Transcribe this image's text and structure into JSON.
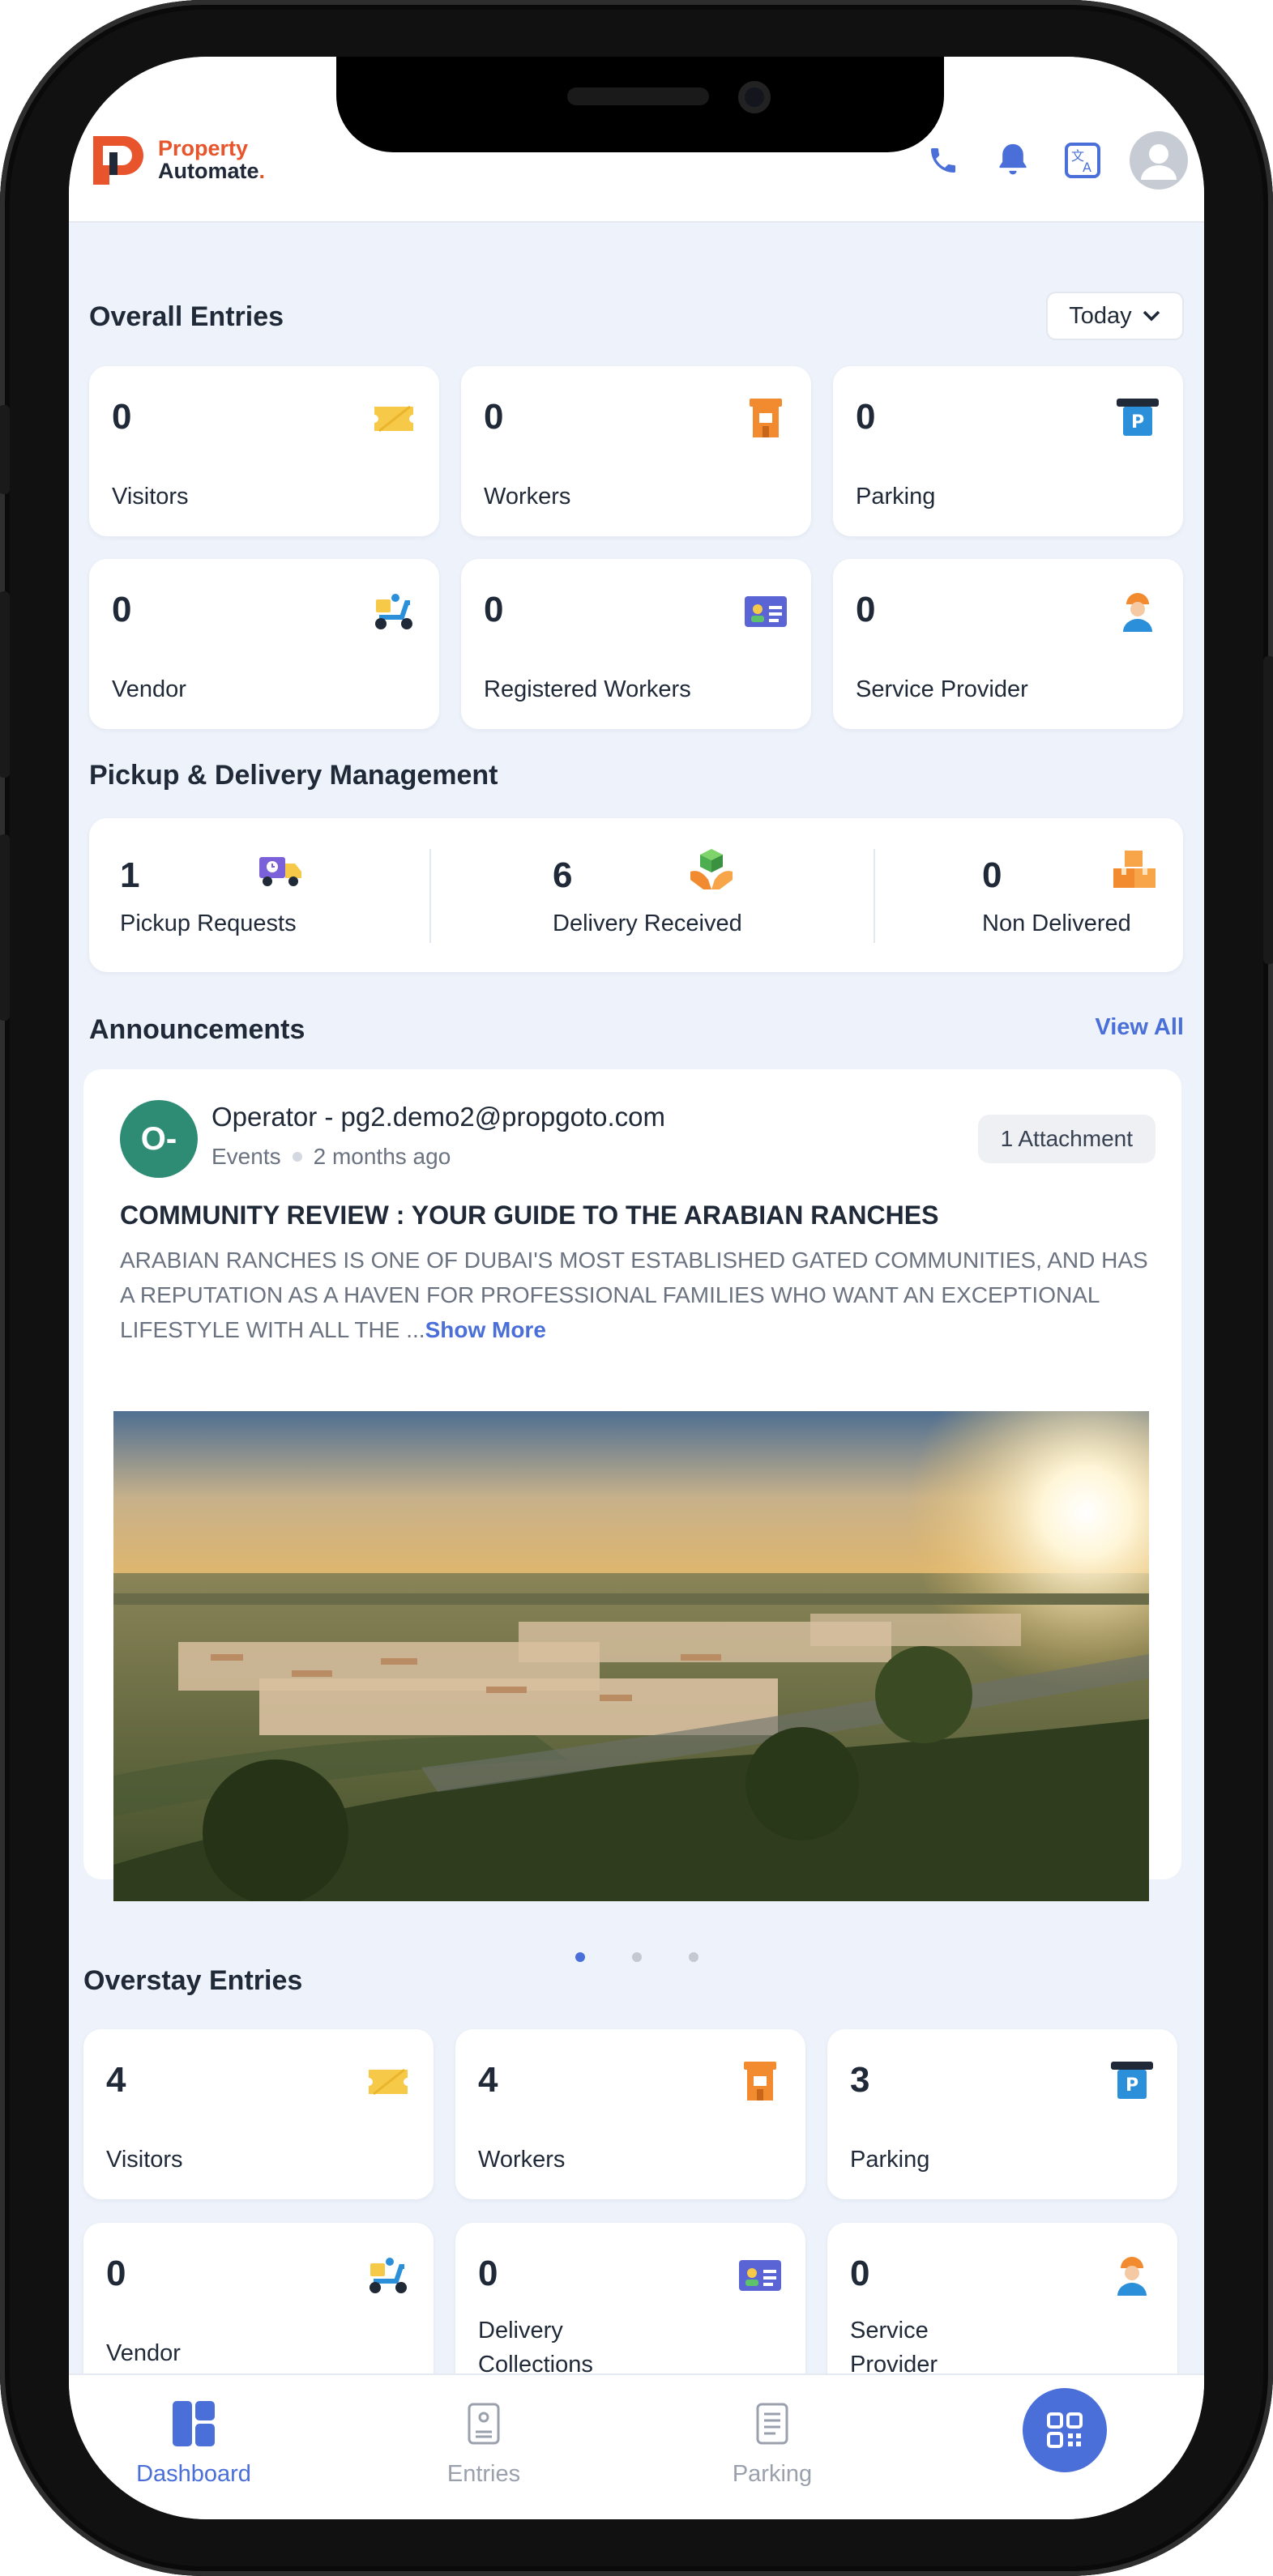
{
  "header": {
    "logo_line1": "Property",
    "logo_line2": "Automate",
    "icons": [
      "phone-icon",
      "bell-icon",
      "translate-icon",
      "avatar"
    ]
  },
  "overall": {
    "title": "Overall Entries",
    "filter": "Today",
    "cards": [
      {
        "value": "0",
        "label": "Visitors",
        "icon": "ticket-icon"
      },
      {
        "value": "0",
        "label": "Workers",
        "icon": "worker-icon"
      },
      {
        "value": "0",
        "label": "Parking",
        "icon": "parking-icon"
      },
      {
        "value": "0",
        "label": "Vendor",
        "icon": "scooter-icon"
      },
      {
        "value": "0",
        "label": "Registered Workers",
        "icon": "id-card-icon"
      },
      {
        "value": "0",
        "label": "Service Provider",
        "icon": "technician-icon"
      }
    ]
  },
  "pickup": {
    "title": "Pickup & Delivery Management",
    "items": [
      {
        "value": "1",
        "label": "Pickup Requests",
        "icon": "delivery-truck-icon"
      },
      {
        "value": "6",
        "label": "Delivery Received",
        "icon": "package-received-icon"
      },
      {
        "value": "0",
        "label": "Non Delivered",
        "icon": "boxes-icon"
      }
    ]
  },
  "announcements": {
    "title": "Announcements",
    "view_all": "View All",
    "avatar_text": "O-",
    "author": "Operator - pg2.demo2@propgoto.com",
    "category": "Events",
    "time": "2 months ago",
    "attachment": "1 Attachment",
    "headline": "COMMUNITY REVIEW : YOUR GUIDE TO THE ARABIAN RANCHES",
    "body": "ARABIAN RANCHES IS ONE OF DUBAI'S MOST ESTABLISHED GATED COMMUNITIES, AND HAS A REPUTATION AS A HAVEN FOR PROFESSIONAL FAMILIES WHO WANT AN EXCEPTIONAL LIFESTYLE WITH ALL THE ...",
    "show_more": "Show More"
  },
  "overstay": {
    "title": "Overstay Entries",
    "cards": [
      {
        "value": "4",
        "label": "Visitors",
        "icon": "ticket-icon"
      },
      {
        "value": "4",
        "label": "Workers",
        "icon": "worker-icon"
      },
      {
        "value": "3",
        "label": "Parking",
        "icon": "parking-icon"
      },
      {
        "value": "0",
        "label": "Vendor",
        "icon": "scooter-icon"
      },
      {
        "value": "0",
        "label_l1": "Delivery",
        "label_l2": "Collections",
        "icon": "id-card-icon"
      },
      {
        "value": "0",
        "label_l1": "Service",
        "label_l2": "Provider",
        "icon": "technician-icon"
      }
    ]
  },
  "nav": {
    "items": [
      {
        "label": "Dashboard",
        "icon": "dashboard-icon",
        "active": true
      },
      {
        "label": "Entries",
        "icon": "entries-icon"
      },
      {
        "label": "Parking",
        "icon": "parking-list-icon"
      }
    ],
    "fab_icon": "qr-code-icon"
  },
  "colors": {
    "accent": "#4a6fd8",
    "brand": "#e8542b",
    "background": "#eef2fa"
  }
}
